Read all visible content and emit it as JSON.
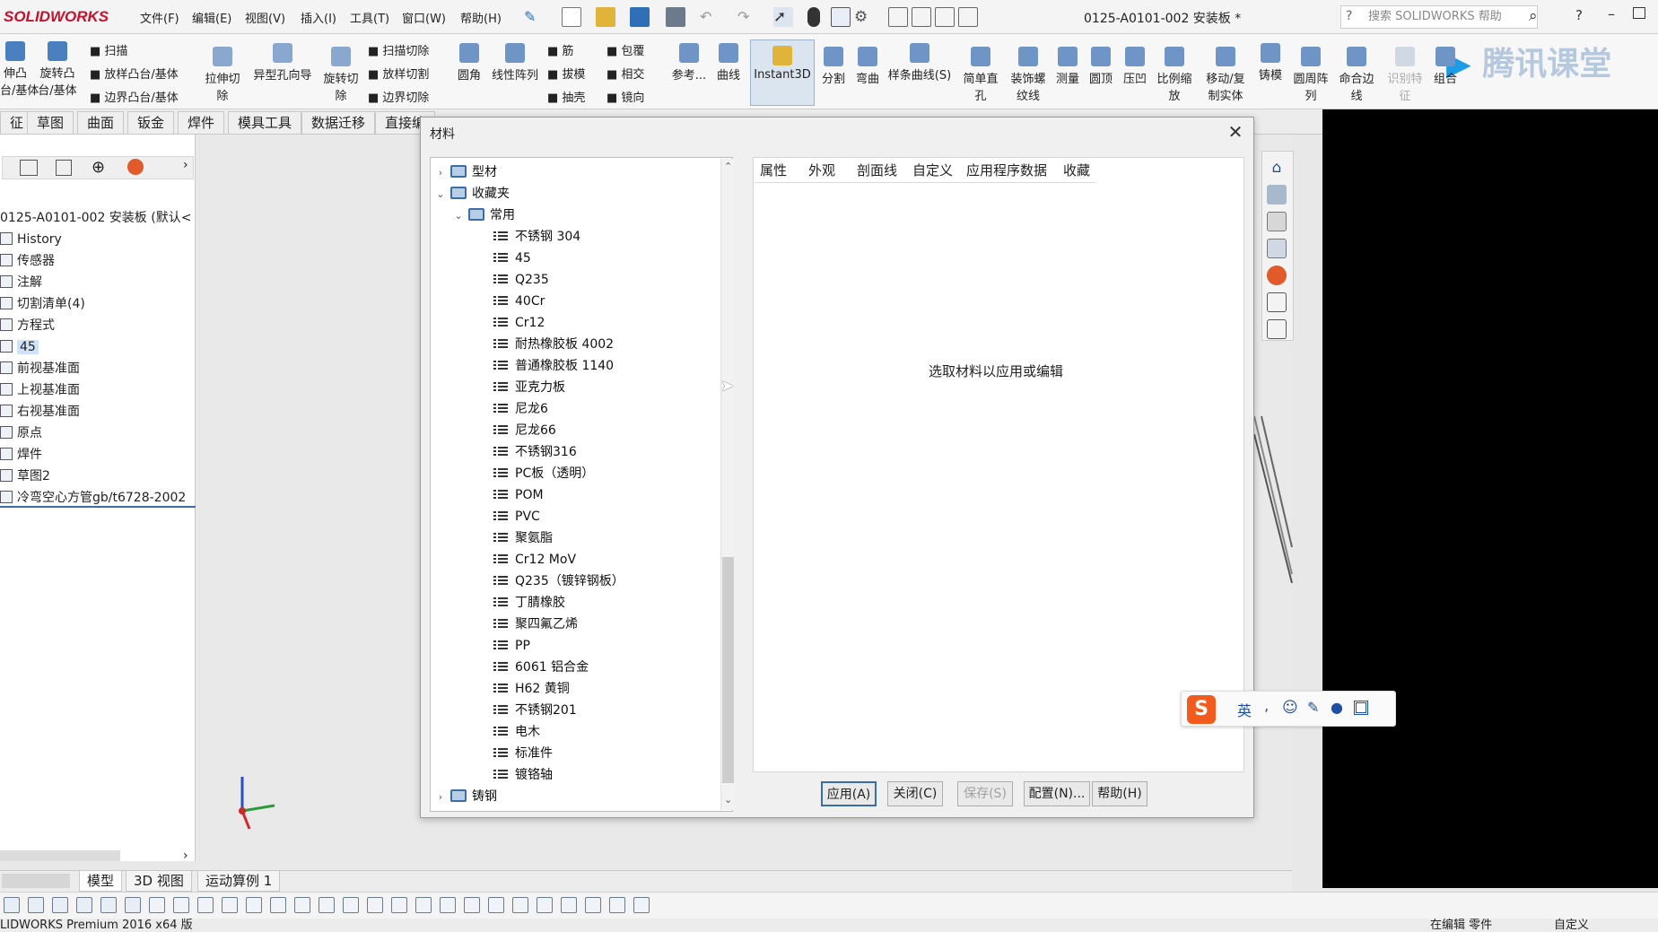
{
  "app": {
    "logo_text": "SOLIDWORKS",
    "document_title": "0125-A0101-002 安装板 *",
    "search_placeholder": "搜索 SOLIDWORKS 帮助",
    "watermark": "腾讯课堂",
    "brand_color": "#c8102e"
  },
  "menu": [
    "文件(F)",
    "编辑(E)",
    "视图(V)",
    "插入(I)",
    "工具(T)",
    "窗口(W)",
    "帮助(H)"
  ],
  "ribbon": {
    "col1": [
      "伸凸",
      "台/基体"
    ],
    "col2": [
      "旋转凸",
      "台/基体"
    ],
    "col3": [
      "扫描",
      "放样凸台/基体",
      "边界凸台/基体"
    ],
    "col4": [
      "拉伸切",
      "除"
    ],
    "col5": [
      "异型孔向导"
    ],
    "col6": [
      "旋转切",
      "除"
    ],
    "col7": [
      "扫描切除",
      "放样切割",
      "边界切除"
    ],
    "col8": [
      "圆角"
    ],
    "col9": [
      "线性阵列"
    ],
    "col10": [
      "筋",
      "拔模",
      "抽壳"
    ],
    "col11": [
      "包覆",
      "相交",
      "镜向"
    ],
    "col12": [
      "参考..."
    ],
    "col13": [
      "曲线"
    ],
    "instant3d": "Instant3D",
    "col14": [
      "分割"
    ],
    "col15": [
      "弯曲"
    ],
    "col16": [
      "样条曲线(S)"
    ],
    "col17": [
      "简单直",
      "孔"
    ],
    "col18": [
      "装饰螺",
      "纹线"
    ],
    "col19": [
      "测量"
    ],
    "col20": [
      "圆顶"
    ],
    "col21": [
      "压凹"
    ],
    "col22": [
      "比例缩",
      "放"
    ],
    "col23": [
      "移动/复",
      "制实体"
    ],
    "col24": [
      "铸模"
    ],
    "col25": [
      "圆周阵",
      "列"
    ],
    "col26": [
      "命合边",
      "线"
    ],
    "col27": [
      "识别特",
      "征"
    ],
    "col28": [
      "组合"
    ]
  },
  "feature_tabs": [
    "征",
    "草图",
    "曲面",
    "钣金",
    "焊件",
    "模具工具",
    "数据迁移",
    "直接编"
  ],
  "feature_tree": {
    "root": "0125-A0101-002 安装板 (默认<",
    "items": [
      "History",
      "传感器",
      "注解",
      "切割清单(4)",
      "方程式",
      "45",
      "前视基准面",
      "上视基准面",
      "右视基准面",
      "原点",
      "焊件",
      "草图2",
      "冷弯空心方管gb/t6728-2002"
    ]
  },
  "dialog": {
    "title": "材料",
    "tree": {
      "top_folder": "型材",
      "favorites": "收藏夹",
      "common": "常用",
      "materials": [
        "不锈钢 304",
        "45",
        "Q235",
        "40Cr",
        "Cr12",
        "耐热橡胶板 4002",
        "普通橡胶板 1140",
        "亚克力板",
        "尼龙6",
        "尼龙66",
        "不锈钢316",
        "PC板（透明）",
        "POM",
        "PVC",
        "聚氨脂",
        "Cr12 MoV",
        "Q235（镀锌钢板）",
        "丁腈橡胶",
        "聚四氟乙烯",
        "PP",
        "6061 铝合金",
        "H62 黄铜",
        "不锈钢201",
        "电木",
        "标准件",
        "镀铬轴"
      ],
      "bottom_folder": "铸钢"
    },
    "tabs": [
      "属性",
      "外观",
      "剖面线",
      "自定义",
      "应用程序数据",
      "收藏"
    ],
    "hint": "选取材料以应用或编辑",
    "buttons": {
      "apply": "应用(A)",
      "close": "关闭(C)",
      "save": "保存(S)",
      "config": "配置(N)...",
      "help": "帮助(H)"
    }
  },
  "bottom_tabs": [
    "模型",
    "3D 视图",
    "运动算例 1"
  ],
  "status": {
    "left": "LIDWORKS Premium 2016 x64 版",
    "mode": "在编辑 零件",
    "custom": "自定义"
  },
  "ime": {
    "lang": "英"
  }
}
